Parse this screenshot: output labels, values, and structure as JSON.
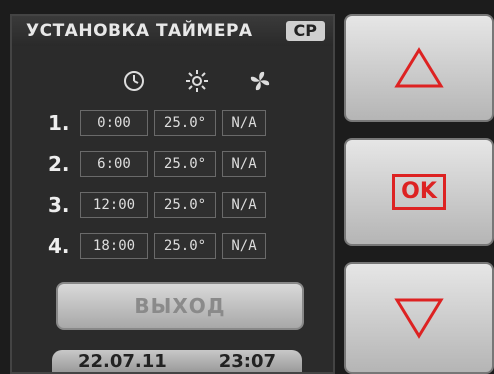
{
  "header": {
    "title": "УСТАНОВКА ТАЙМЕРА",
    "mode_badge": "CP"
  },
  "columns": {
    "icons": [
      "clock-icon",
      "sun-icon",
      "fan-icon"
    ]
  },
  "rows": [
    {
      "num": "1.",
      "time": "0:00",
      "temp": "25.0°",
      "fan": "N/A"
    },
    {
      "num": "2.",
      "time": "6:00",
      "temp": "25.0°",
      "fan": "N/A"
    },
    {
      "num": "3.",
      "time": "12:00",
      "temp": "25.0°",
      "fan": "N/A"
    },
    {
      "num": "4.",
      "time": "18:00",
      "temp": "25.0°",
      "fan": "N/A"
    }
  ],
  "exit_button": {
    "label": "ВЫХОД"
  },
  "status": {
    "date": "22.07.11",
    "time": "23:07"
  },
  "side_buttons": {
    "ok_label": "OK"
  },
  "colors": {
    "accent": "#dd2222",
    "screen_bg": "#2b2b2b"
  }
}
